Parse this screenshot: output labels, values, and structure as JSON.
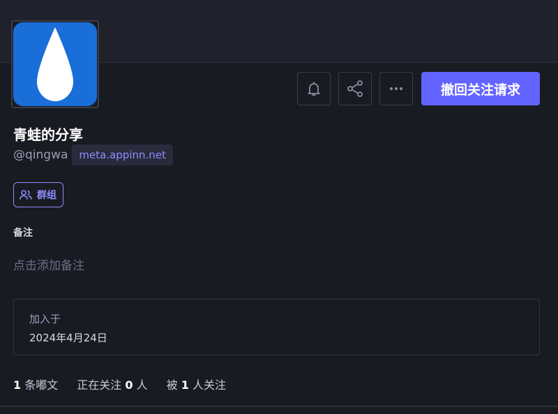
{
  "profile": {
    "display_name": "青蛙的分享",
    "handle": "@qingwa",
    "domain": "meta.appinn.net",
    "group_label": "群组",
    "note_label": "备注",
    "note_placeholder": "点击添加备注",
    "joined_label": "加入于",
    "joined_date": "2024年4月24日"
  },
  "actions": {
    "primary_label": "撤回关注请求",
    "bell_icon": "bell-icon",
    "share_icon": "share-icon",
    "more_icon": "more-horizontal-icon"
  },
  "stats": [
    {
      "count": "1",
      "label": "条嘟文",
      "prefix": ""
    },
    {
      "count": "0",
      "label": "人",
      "prefix": "正在关注"
    },
    {
      "count": "1",
      "label": "人关注",
      "prefix": "被"
    }
  ],
  "colors": {
    "accent": "#6364ff",
    "accent_text": "#8c8dff",
    "avatar_bg": "#1a6ed8",
    "background": "#191b22"
  }
}
